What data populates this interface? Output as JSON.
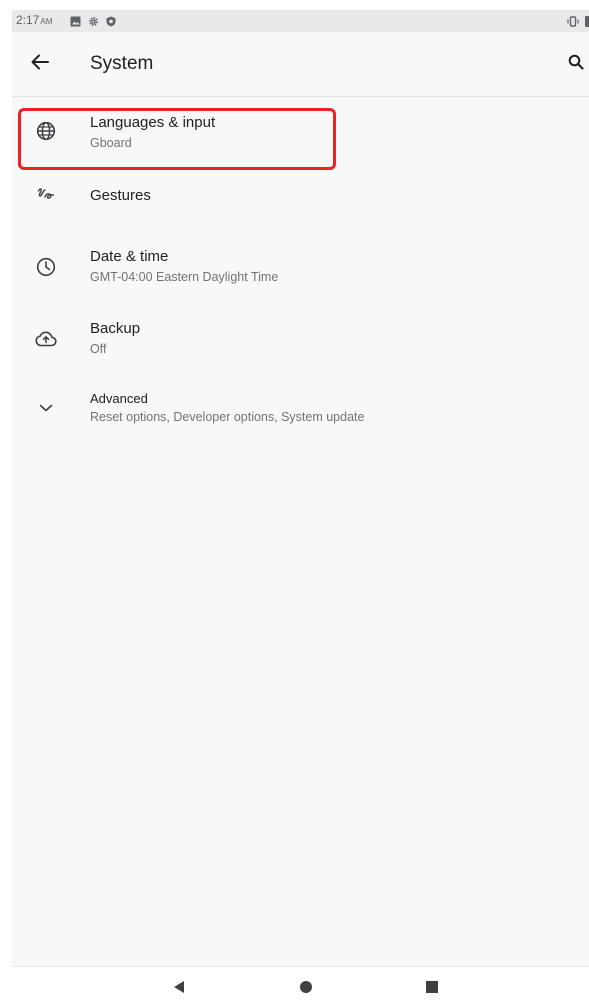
{
  "status_bar": {
    "time": "2:17",
    "ampm": "AM",
    "icons": [
      "image-icon",
      "settings-gear-icon",
      "shield-icon"
    ],
    "right_icons": [
      "vibrate-icon",
      "battery-icon"
    ]
  },
  "app_bar": {
    "title": "System",
    "back_icon": "arrow-back-icon",
    "search_icon": "search-icon"
  },
  "items": [
    {
      "icon": "globe-icon",
      "title": "Languages & input",
      "summary": "Gboard"
    },
    {
      "icon": "gestures-icon",
      "title": "Gestures",
      "summary": ""
    },
    {
      "icon": "clock-icon",
      "title": "Date & time",
      "summary": "GMT-04:00 Eastern Daylight Time"
    },
    {
      "icon": "cloud-upload-icon",
      "title": "Backup",
      "summary": "Off"
    },
    {
      "icon": "chevron-down-icon",
      "title": "Advanced",
      "summary": "Reset options, Developer options, System update"
    }
  ],
  "highlight": {
    "color": "#ee2222",
    "target": "Languages & input"
  },
  "nav_bar": {
    "buttons": [
      "back-triangle-icon",
      "home-circle-icon",
      "recents-square-icon"
    ]
  }
}
